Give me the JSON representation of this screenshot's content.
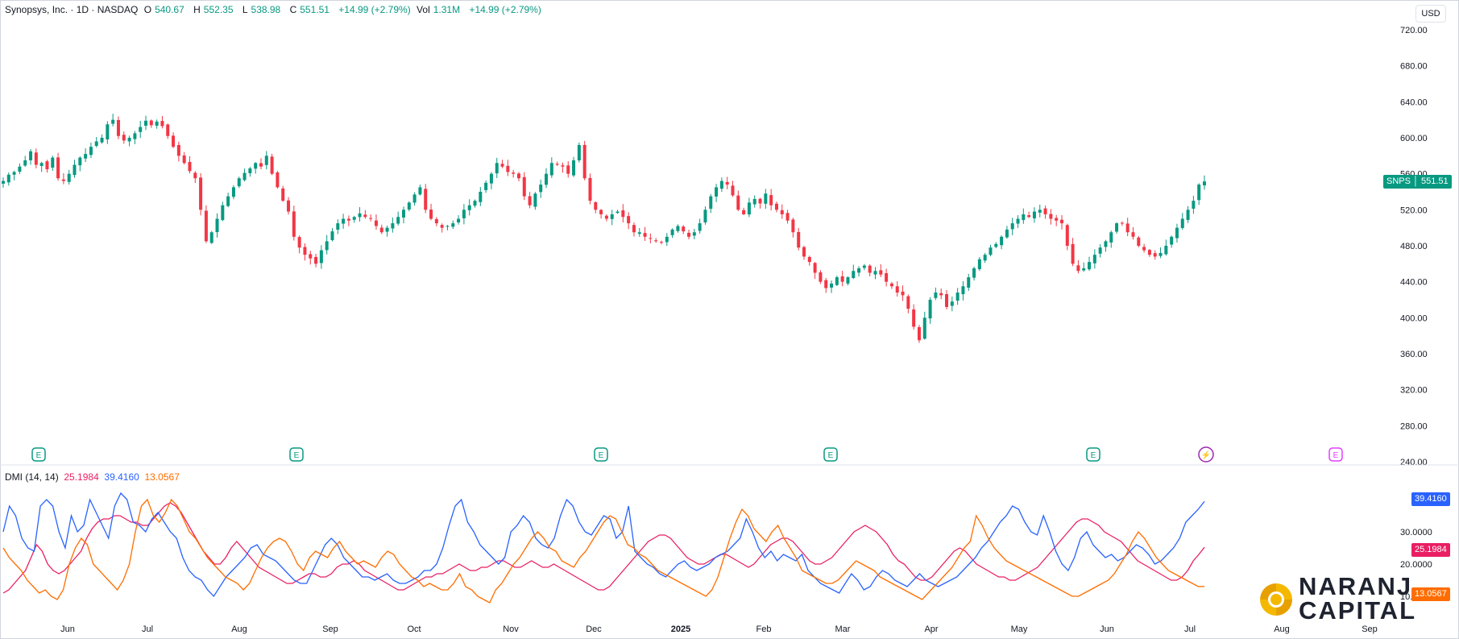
{
  "header": {
    "symbol_label": "Synopsys, Inc. · 1D · NASDAQ",
    "open_label": "O",
    "open_value": "540.67",
    "high_label": "H",
    "high_value": "552.35",
    "low_label": "L",
    "low_value": "538.98",
    "close_label": "C",
    "close_value": "551.51",
    "change": "+14.99 (+2.79%)",
    "vol_label": "Vol",
    "vol_value": "1.31M",
    "vol_change": "+14.99 (+2.79%)"
  },
  "currency": "USD",
  "price_badge": {
    "ticker": "SNPS",
    "value": "551.51"
  },
  "indicator": {
    "name": "DMI (14, 14)",
    "adx": "25.1984",
    "plus_di": "39.4160",
    "minus_di": "13.0567"
  },
  "brand": {
    "line1": "NARANJ",
    "line2": "CAPITAL"
  },
  "colors": {
    "up": "#089981",
    "down": "#f23645",
    "adx": "#e91e63",
    "plus_di": "#2962ff",
    "minus_di": "#ff6d00",
    "earnings": "#089981",
    "dividend": "#9c27b0",
    "future_earnings": "#e040fb"
  },
  "chart_data": [
    {
      "type": "candlestick",
      "title": "Synopsys, Inc. · 1D · NASDAQ",
      "ylim": [
        240,
        720
      ],
      "y_ticks": [
        "720.00",
        "680.00",
        "640.00",
        "600.00",
        "560.00",
        "520.00",
        "480.00",
        "440.00",
        "400.00",
        "360.00",
        "320.00",
        "280.00",
        "240.00"
      ],
      "x_ticks": [
        "Jun",
        "Jul",
        "Aug",
        "Sep",
        "Oct",
        "Nov",
        "Dec",
        "2025",
        "Feb",
        "Mar",
        "Apr",
        "May",
        "Jun",
        "Jul",
        "Aug",
        "Sep"
      ],
      "events": [
        {
          "label": "E",
          "month": "May 2024",
          "kind": "earnings"
        },
        {
          "label": "E",
          "month": "Aug 2024",
          "kind": "earnings"
        },
        {
          "label": "E",
          "month": "Dec 2024",
          "kind": "earnings"
        },
        {
          "label": "E",
          "month": "Feb 2025",
          "kind": "earnings"
        },
        {
          "label": "E",
          "month": "May 2025",
          "kind": "earnings"
        },
        {
          "label": "⚡",
          "month": "Jul 2025",
          "kind": "dividend"
        },
        {
          "label": "E",
          "month": "Aug 2025",
          "kind": "future_earnings"
        }
      ],
      "closes": [
        552,
        559,
        562,
        568,
        575,
        585,
        570,
        572,
        565,
        578,
        555,
        552,
        560,
        570,
        578,
        582,
        590,
        596,
        600,
        615,
        620,
        602,
        597,
        600,
        605,
        612,
        619,
        614,
        618,
        613,
        602,
        590,
        580,
        572,
        563,
        555,
        520,
        485,
        495,
        510,
        525,
        535,
        545,
        555,
        561,
        566,
        572,
        568,
        580,
        560,
        545,
        530,
        518,
        490,
        478,
        470,
        466,
        460,
        475,
        485,
        496,
        505,
        510,
        508,
        512,
        516,
        512,
        510,
        502,
        495,
        500,
        505,
        512,
        520,
        528,
        537,
        545,
        520,
        510,
        505,
        500,
        502,
        505,
        510,
        520,
        525,
        530,
        540,
        550,
        560,
        572,
        568,
        562,
        560,
        555,
        535,
        525,
        538,
        548,
        560,
        572,
        570,
        568,
        560,
        575,
        592,
        555,
        530,
        520,
        515,
        510,
        515,
        518,
        512,
        505,
        495,
        495,
        490,
        488,
        485,
        484,
        490,
        498,
        502,
        496,
        490,
        495,
        505,
        520,
        535,
        545,
        552,
        548,
        536,
        520,
        515,
        528,
        532,
        527,
        538,
        525,
        520,
        515,
        508,
        495,
        478,
        468,
        462,
        450,
        440,
        433,
        438,
        445,
        440,
        445,
        452,
        455,
        458,
        450,
        452,
        448,
        440,
        435,
        428,
        425,
        410,
        390,
        375,
        400,
        420,
        428,
        425,
        412,
        418,
        428,
        435,
        445,
        455,
        465,
        470,
        478,
        482,
        490,
        498,
        505,
        510,
        515,
        512,
        518,
        520,
        515,
        510,
        508,
        505,
        480,
        460,
        452,
        455,
        462,
        470,
        478,
        485,
        495,
        505,
        505,
        495,
        490,
        480,
        475,
        470,
        468,
        472,
        480,
        490,
        500,
        510,
        520,
        530,
        548,
        551.51
      ],
      "ylabel": ""
    },
    {
      "type": "line",
      "title": "DMI (14, 14)",
      "ylim": [
        5,
        45
      ],
      "y_ticks": [
        "30.0000",
        "20.0000",
        "10.0000"
      ],
      "series": [
        {
          "name": "ADX",
          "last": 25.1984,
          "values": [
            11,
            12,
            14,
            16,
            18,
            22,
            26,
            24,
            20,
            18,
            17,
            18,
            20,
            22,
            24,
            28,
            31,
            33,
            34,
            34,
            35,
            35,
            34,
            33,
            33,
            32,
            32,
            34,
            36,
            38,
            39,
            38,
            36,
            33,
            30,
            27,
            24,
            22,
            20,
            20,
            22,
            25,
            27,
            25,
            23,
            21,
            19,
            18,
            17,
            16,
            15,
            14,
            14,
            15,
            16,
            17,
            17,
            16,
            16,
            17,
            19,
            20,
            20,
            21,
            20,
            18,
            17,
            16,
            15,
            14,
            13,
            12,
            12,
            13,
            14,
            15,
            16,
            16,
            17,
            17,
            18,
            19,
            20,
            19,
            18,
            18,
            19,
            19,
            20,
            21,
            21,
            20,
            19,
            19,
            20,
            21,
            20,
            19,
            19,
            20,
            19,
            18,
            17,
            16,
            15,
            14,
            13,
            12,
            12,
            13,
            15,
            17,
            19,
            21,
            23,
            25,
            27,
            28,
            29,
            29,
            28,
            26,
            24,
            22,
            21,
            20,
            20,
            21,
            22,
            23,
            23,
            22,
            21,
            20,
            19,
            20,
            22,
            24,
            26,
            27,
            28,
            28,
            27,
            25,
            23,
            21,
            20,
            20,
            21,
            22,
            24,
            26,
            28,
            30,
            31,
            32,
            31,
            30,
            28,
            26,
            23,
            21,
            20,
            18,
            16,
            15,
            15,
            16,
            18,
            20,
            22,
            24,
            25,
            24,
            22,
            20,
            19,
            18,
            17,
            16,
            16,
            15,
            15,
            16,
            17,
            18,
            19,
            21,
            23,
            25,
            27,
            29,
            31,
            33,
            34,
            34,
            33,
            32,
            30,
            29,
            28,
            27,
            25,
            23,
            21,
            20,
            19,
            18,
            17,
            16,
            15,
            15,
            16,
            18,
            21,
            23,
            25.1984
          ]
        },
        {
          "name": "+DI",
          "last": 39.416,
          "values": [
            30,
            38,
            35,
            28,
            25,
            24,
            38,
            40,
            38,
            30,
            25,
            35,
            30,
            32,
            40,
            36,
            32,
            28,
            38,
            42,
            40,
            33,
            32,
            30,
            34,
            36,
            33,
            30,
            28,
            22,
            18,
            16,
            15,
            12,
            10,
            13,
            16,
            18,
            20,
            22,
            25,
            26,
            23,
            22,
            21,
            19,
            17,
            15,
            14,
            14,
            18,
            22,
            26,
            28,
            26,
            22,
            20,
            18,
            16,
            16,
            15,
            16,
            17,
            15,
            14,
            14,
            15,
            16,
            18,
            18,
            20,
            25,
            32,
            38,
            40,
            33,
            30,
            26,
            24,
            22,
            20,
            22,
            30,
            32,
            35,
            33,
            28,
            26,
            25,
            28,
            35,
            40,
            38,
            33,
            30,
            29,
            32,
            35,
            34,
            28,
            30,
            38,
            24,
            22,
            20,
            19,
            17,
            16,
            18,
            20,
            21,
            19,
            18,
            19,
            20,
            22,
            23,
            24,
            26,
            28,
            34,
            30,
            25,
            22,
            24,
            21,
            23,
            22,
            21,
            23,
            18,
            16,
            14,
            13,
            12,
            11,
            14,
            17,
            15,
            12,
            13,
            16,
            18,
            17,
            15,
            14,
            13,
            15,
            17,
            15,
            14,
            13,
            14,
            15,
            16,
            18,
            20,
            22,
            25,
            27,
            30,
            33,
            35,
            38,
            37,
            33,
            30,
            29,
            35,
            30,
            24,
            20,
            18,
            22,
            28,
            30,
            26,
            24,
            22,
            23,
            21,
            22,
            24,
            26,
            25,
            23,
            20,
            21,
            23,
            25,
            28,
            33,
            35,
            37,
            39.416
          ]
        },
        {
          "name": "-DI",
          "last": 13.0567,
          "values": [
            25,
            22,
            20,
            18,
            15,
            13,
            11,
            12,
            10,
            9,
            12,
            20,
            25,
            28,
            26,
            20,
            18,
            16,
            14,
            12,
            15,
            20,
            30,
            38,
            40,
            35,
            33,
            36,
            40,
            38,
            34,
            30,
            28,
            25,
            22,
            20,
            18,
            16,
            15,
            14,
            12,
            14,
            18,
            22,
            25,
            27,
            28,
            27,
            24,
            20,
            18,
            22,
            24,
            23,
            22,
            25,
            27,
            24,
            22,
            20,
            21,
            20,
            19,
            22,
            24,
            23,
            20,
            18,
            16,
            15,
            13,
            14,
            13,
            12,
            12,
            14,
            17,
            13,
            12,
            10,
            9,
            8,
            12,
            14,
            17,
            20,
            22,
            25,
            28,
            30,
            28,
            25,
            24,
            21,
            20,
            19,
            22,
            24,
            27,
            30,
            33,
            35,
            34,
            30,
            26,
            25,
            23,
            22,
            20,
            18,
            17,
            16,
            15,
            14,
            13,
            12,
            11,
            10,
            12,
            16,
            22,
            28,
            33,
            37,
            35,
            31,
            29,
            27,
            30,
            32,
            28,
            25,
            22,
            18,
            17,
            16,
            15,
            14,
            14,
            15,
            17,
            19,
            21,
            20,
            19,
            18,
            16,
            15,
            14,
            13,
            12,
            11,
            10,
            9,
            11,
            13,
            15,
            17,
            19,
            22,
            25,
            27,
            35,
            32,
            28,
            25,
            23,
            21,
            20,
            19,
            18,
            17,
            16,
            15,
            14,
            13,
            12,
            11,
            10,
            10,
            11,
            12,
            13,
            14,
            15,
            17,
            20,
            23,
            27,
            30,
            28,
            25,
            22,
            20,
            18,
            17,
            16,
            15,
            14,
            13,
            13.0567
          ]
        }
      ]
    }
  ]
}
